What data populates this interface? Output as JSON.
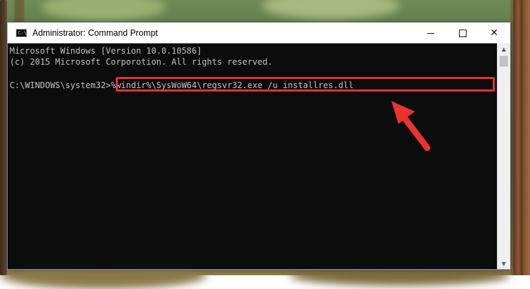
{
  "window": {
    "title": "Administrator: Command Prompt",
    "app_icon_glyph": "C:\\",
    "controls": {
      "minimize": "minimize-icon",
      "maximize": "maximize-icon",
      "close": "close-icon",
      "close_glyph": "✕"
    }
  },
  "console": {
    "lines": [
      "Microsoft Windows [Version 10.0.10586]",
      "(c) 2015 Microsoft Corporotion. All rights reserved."
    ],
    "prompt": "C:\\WINDOWS\\system32>",
    "command": "%windir%\\SysWoW64\\regsvr32.exe /u installres.dll"
  },
  "scrollbar": {
    "up_glyph": "▲",
    "down_glyph": "▼"
  },
  "colors": {
    "console_bg": "#0c0c0c",
    "console_text": "#c0c0c0",
    "highlight": "#e8332f"
  }
}
